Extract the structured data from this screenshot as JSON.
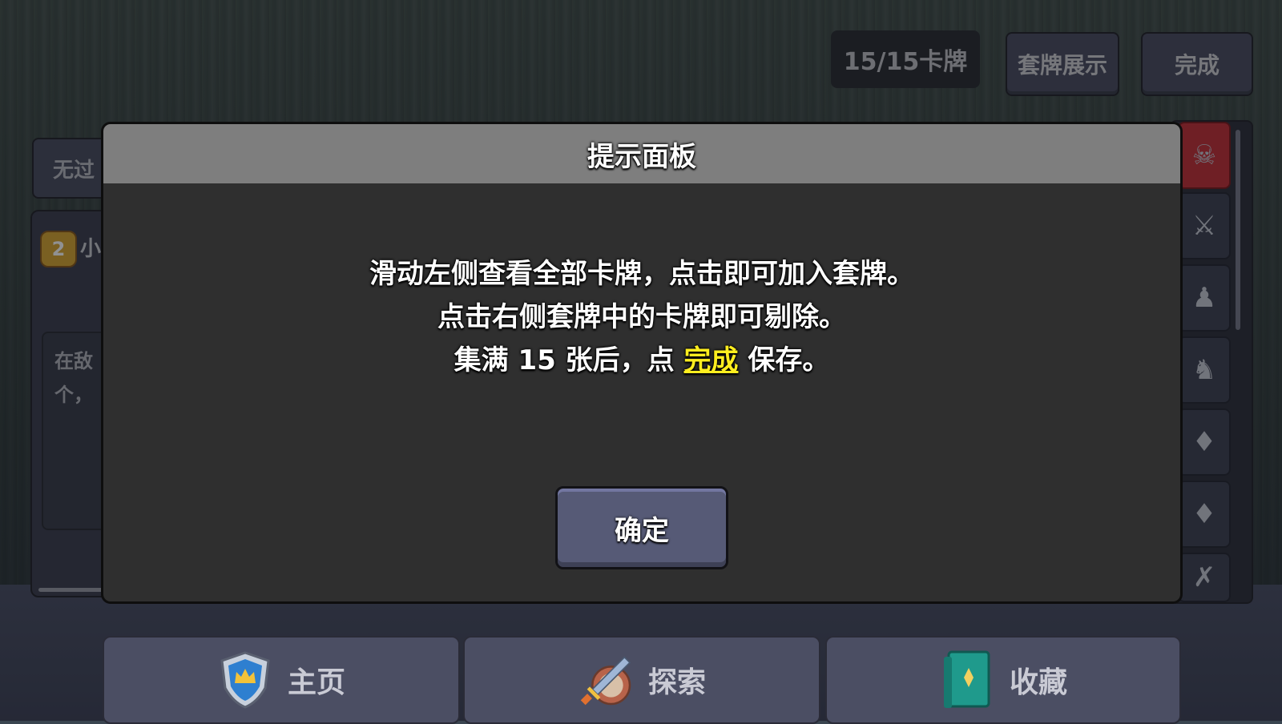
{
  "header": {
    "deck_count": "15/15卡牌",
    "deck_show_label": "套牌展示",
    "done_label": "完成"
  },
  "left": {
    "tab_label": "无过",
    "card_badge": "2",
    "card_name": "小",
    "desc_line1": "在敌",
    "desc_line2": "个，"
  },
  "right_rail": {
    "icons": [
      "beast-icon",
      "sword-unit-icon",
      "boot-unit-icon",
      "hat-unit-icon",
      "crystal-unit-icon",
      "crystal-unit-icon",
      "crossed-swords-unit-icon"
    ]
  },
  "dialog": {
    "title": "提示面板",
    "line1": "滑动左侧查看全部卡牌，点击即可加入套牌。",
    "line2": "点击右侧套牌中的卡牌即可剔除。",
    "line3_prefix": "集满 15 张后，点 ",
    "line3_highlight": "完成",
    "line3_suffix": " 保存。",
    "confirm_label": "确定",
    "highlight_color": "#ffee1f"
  },
  "bottom_nav": {
    "home_label": "主页",
    "explore_label": "探索",
    "collect_label": "收藏"
  }
}
